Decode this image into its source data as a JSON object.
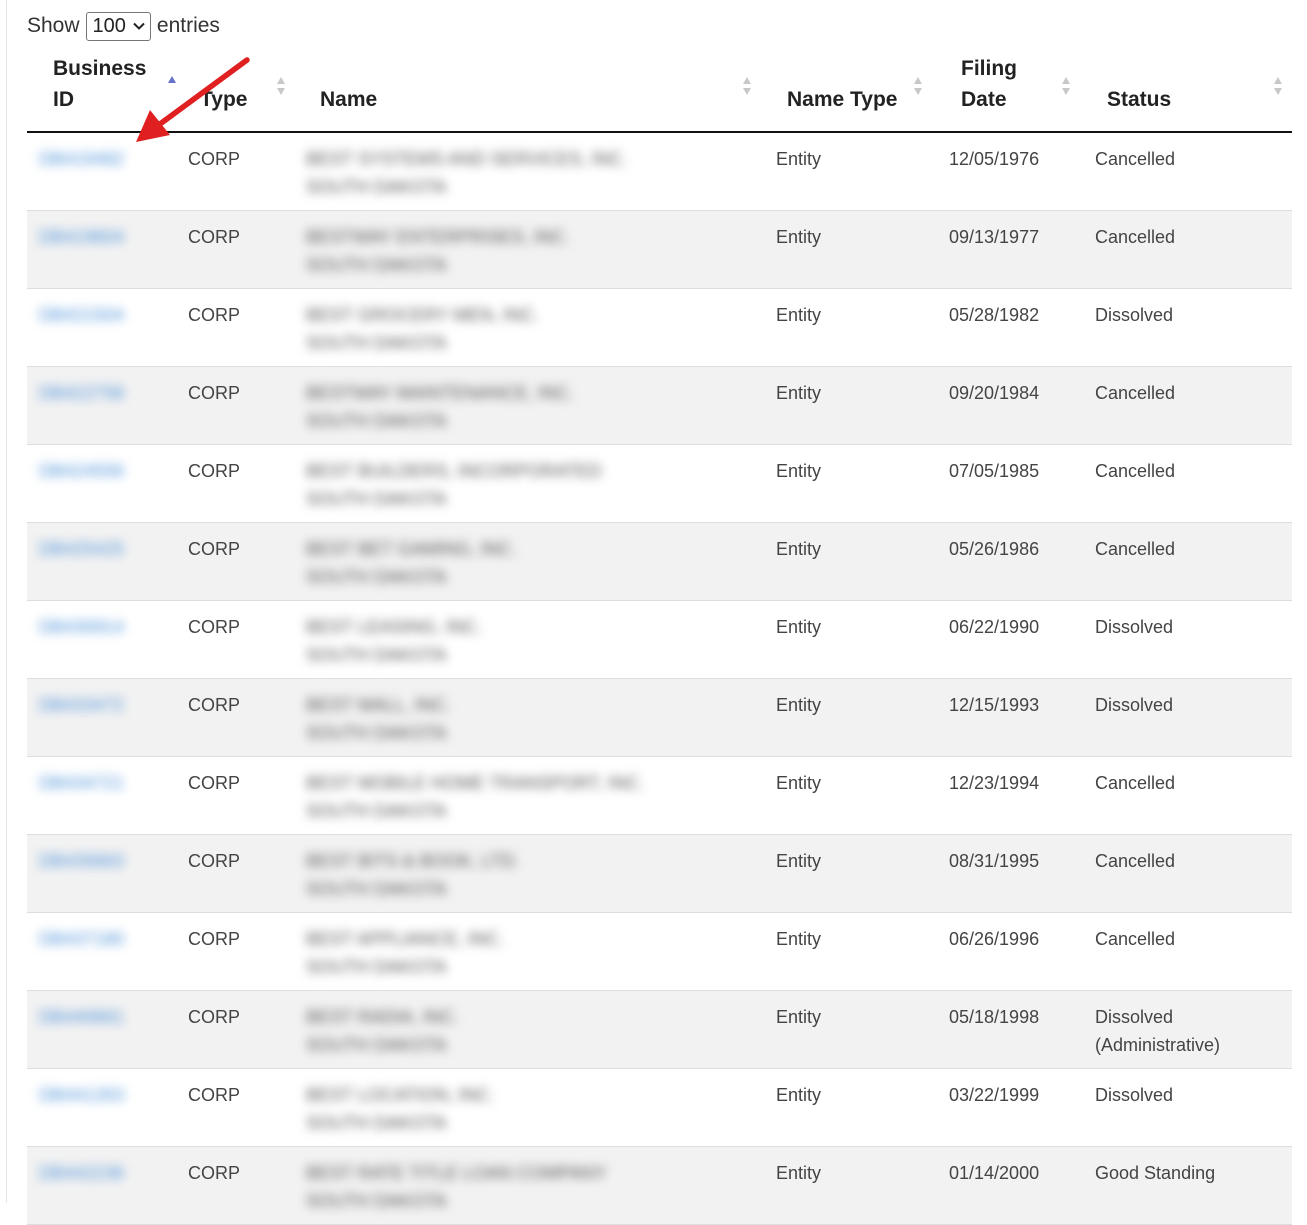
{
  "length": {
    "show_label": "Show",
    "selected": "100",
    "entries_label": "entries"
  },
  "columns": {
    "business_id": {
      "line1": "Business",
      "line2": "ID"
    },
    "type": "Type",
    "name": "Name",
    "name_type": "Name Type",
    "filing_date": {
      "line1": "Filing",
      "line2": "Date"
    },
    "status": "Status"
  },
  "rows": [
    {
      "id": "DB419482",
      "type": "CORP",
      "name": "BEST SYSTEMS AND SERVICES, INC.",
      "state": "SOUTH DAKOTA",
      "name_type": "Entity",
      "filing_date": "12/05/1976",
      "status": "Cancelled"
    },
    {
      "id": "DB419604",
      "type": "CORP",
      "name": "BESTWAY ENTERPRISES, INC.",
      "state": "SOUTH DAKOTA",
      "name_type": "Entity",
      "filing_date": "09/13/1977",
      "status": "Cancelled"
    },
    {
      "id": "DB421504",
      "type": "CORP",
      "name": "BEST GROCERY MEN, INC.",
      "state": "SOUTH DAKOTA",
      "name_type": "Entity",
      "filing_date": "05/28/1982",
      "status": "Dissolved"
    },
    {
      "id": "DB422758",
      "type": "CORP",
      "name": "BESTWAY MAINTENANCE, INC.",
      "state": "SOUTH DAKOTA",
      "name_type": "Entity",
      "filing_date": "09/20/1984",
      "status": "Cancelled"
    },
    {
      "id": "DB424556",
      "type": "CORP",
      "name": "BEST BUILDERS, INCORPORATED",
      "state": "SOUTH DAKOTA",
      "name_type": "Entity",
      "filing_date": "07/05/1985",
      "status": "Cancelled"
    },
    {
      "id": "DB425425",
      "type": "CORP",
      "name": "BEST BET GAMING, INC.",
      "state": "SOUTH DAKOTA",
      "name_type": "Entity",
      "filing_date": "05/26/1986",
      "status": "Cancelled"
    },
    {
      "id": "DB430914",
      "type": "CORP",
      "name": "BEST LEASING, INC.",
      "state": "SOUTH DAKOTA",
      "name_type": "Entity",
      "filing_date": "06/22/1990",
      "status": "Dissolved"
    },
    {
      "id": "DB433472",
      "type": "CORP",
      "name": "BEST MALL, INC.",
      "state": "SOUTH DAKOTA",
      "name_type": "Entity",
      "filing_date": "12/15/1993",
      "status": "Dissolved"
    },
    {
      "id": "DB434721",
      "type": "CORP",
      "name": "BEST MOBILE HOME TRANSPORT, INC.",
      "state": "SOUTH DAKOTA",
      "name_type": "Entity",
      "filing_date": "12/23/1994",
      "status": "Cancelled"
    },
    {
      "id": "DB435663",
      "type": "CORP",
      "name": "BEST BITS & BOOK, LTD.",
      "state": "SOUTH DAKOTA",
      "name_type": "Entity",
      "filing_date": "08/31/1995",
      "status": "Cancelled"
    },
    {
      "id": "DB437180",
      "type": "CORP",
      "name": "BEST APPLIANCE, INC.",
      "state": "SOUTH DAKOTA",
      "name_type": "Entity",
      "filing_date": "06/26/1996",
      "status": "Cancelled"
    },
    {
      "id": "DB440661",
      "type": "CORP",
      "name": "BEST RADIA, INC.",
      "state": "SOUTH DAKOTA",
      "name_type": "Entity",
      "filing_date": "05/18/1998",
      "status": "Dissolved (Administrative)"
    },
    {
      "id": "DB441263",
      "type": "CORP",
      "name": "BEST LOCATION, INC.",
      "state": "SOUTH DAKOTA",
      "name_type": "Entity",
      "filing_date": "03/22/1999",
      "status": "Dissolved"
    },
    {
      "id": "DB442236",
      "type": "CORP",
      "name": "BEST RATE TITLE LOAN COMPANY",
      "state": "SOUTH DAKOTA",
      "name_type": "Entity",
      "filing_date": "01/14/2000",
      "status": "Good Standing"
    }
  ],
  "colors": {
    "link": "#4a90d9",
    "sort_active": "#6673c8",
    "sort_inactive": "#c8c8c8",
    "annotation_arrow": "#e02020",
    "stripe": "#f2f2f2"
  }
}
